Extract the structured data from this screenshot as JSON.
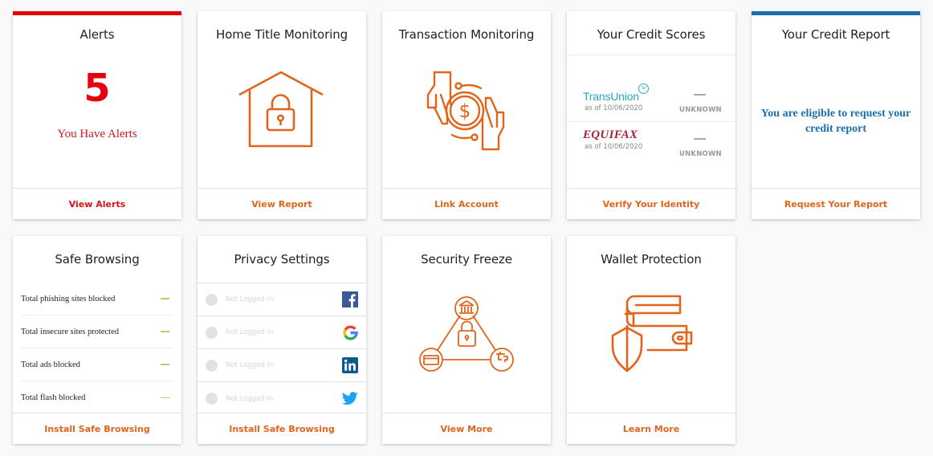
{
  "colors": {
    "alert_red": "#e3000f",
    "accent_orange": "#e0641a",
    "report_blue": "#1a6fb0",
    "transunion_teal": "#26a8c7",
    "equifax_maroon": "#a4233a",
    "safe_browsing_dash": "#b5cf6a"
  },
  "cards": {
    "alerts": {
      "title": "Alerts",
      "count": "5",
      "message": "You Have Alerts",
      "action": "View Alerts",
      "icon": "none"
    },
    "home_title": {
      "title": "Home Title Monitoring",
      "icon": "house-lock-icon",
      "action": "View Report"
    },
    "transaction": {
      "title": "Transaction Monitoring",
      "icon": "hands-coin-icon",
      "action": "Link Account"
    },
    "credit_scores": {
      "title": "Your Credit Scores",
      "bureaus": [
        {
          "name": "TransUnion",
          "badge": "tu",
          "as_of": "as of 10/06/2020",
          "score": "—",
          "status": "UNKNOWN"
        },
        {
          "name": "EQUIFAX",
          "as_of": "as of 10/06/2020",
          "score": "—",
          "status": "UNKNOWN"
        }
      ],
      "action": "Verify Your Identity"
    },
    "credit_report": {
      "title": "Your Credit Report",
      "message": "You are eligible to request your credit report",
      "action": "Request Your Report"
    },
    "safe_browsing": {
      "title": "Safe Browsing",
      "stats": [
        {
          "label": "Total phishing sites blocked",
          "value": "—"
        },
        {
          "label": "Total insecure sites protected",
          "value": "—"
        },
        {
          "label": "Total ads blocked",
          "value": "—"
        },
        {
          "label": "Total flash blocked",
          "value": "—"
        }
      ],
      "action": "Install Safe Browsing"
    },
    "privacy": {
      "title": "Privacy Settings",
      "accounts": [
        {
          "service": "facebook",
          "icon": "facebook-icon",
          "status": "Not Logged In"
        },
        {
          "service": "google",
          "icon": "google-icon",
          "status": "Not Logged In"
        },
        {
          "service": "linkedin",
          "icon": "linkedin-icon",
          "status": "Not Logged In"
        },
        {
          "service": "twitter",
          "icon": "twitter-icon",
          "status": "Not Logged In"
        }
      ],
      "action": "Install Safe Browsing"
    },
    "security_freeze": {
      "title": "Security Freeze",
      "icon": "security-freeze-network-icon",
      "action": "View More"
    },
    "wallet": {
      "title": "Wallet Protection",
      "icon": "wallet-shield-icon",
      "action": "Learn More"
    }
  }
}
